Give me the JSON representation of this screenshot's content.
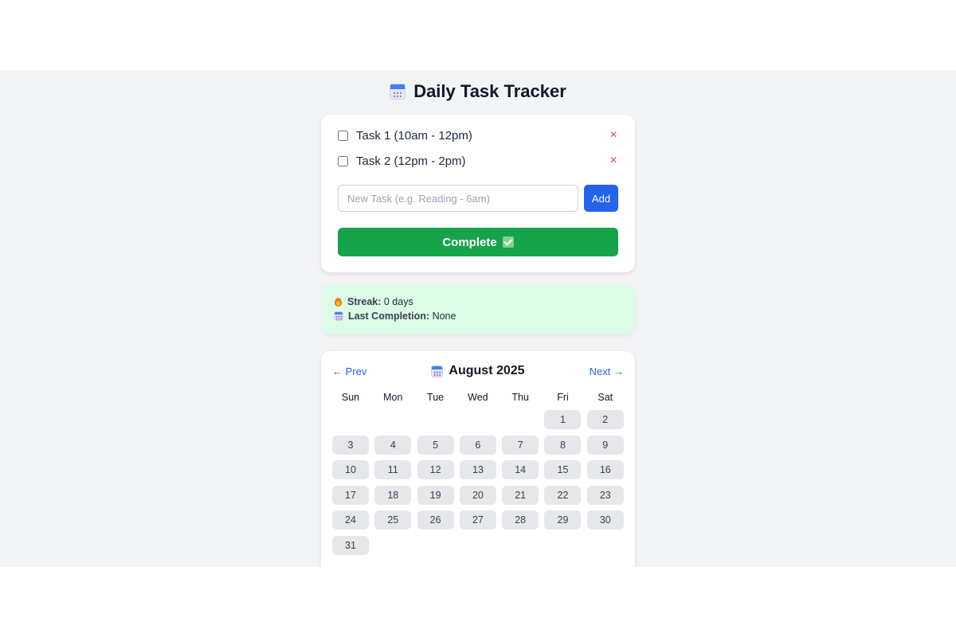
{
  "app": {
    "title": "Daily Task Tracker",
    "title_icon": "calendar-icon"
  },
  "tasks": [
    {
      "label": "Task 1 (10am - 12pm)",
      "checked": false,
      "remove": "×"
    },
    {
      "label": "Task 2 (12pm - 2pm)",
      "checked": false,
      "remove": "×"
    }
  ],
  "new_task": {
    "placeholder": "New Task (e.g. Reading - 6am)",
    "value": "",
    "add_label": "Add"
  },
  "complete": {
    "label": "Complete",
    "icon": "check-box-icon"
  },
  "stats": {
    "streak_label": "Streak:",
    "streak_value": "0 days",
    "streak_icon": "flame-icon",
    "last_label": "Last Completion:",
    "last_value": "None",
    "last_icon": "calendar-icon"
  },
  "calendar": {
    "prev_label": "← Prev",
    "next_label": "Next →",
    "month_label": "August 2025",
    "weekdays": [
      "Sun",
      "Mon",
      "Tue",
      "Wed",
      "Thu",
      "Fri",
      "Sat"
    ],
    "weeks": [
      [
        "",
        "",
        "",
        "",
        "",
        "1",
        "2"
      ],
      [
        "3",
        "4",
        "5",
        "6",
        "7",
        "8",
        "9"
      ],
      [
        "10",
        "11",
        "12",
        "13",
        "14",
        "15",
        "16"
      ],
      [
        "17",
        "18",
        "19",
        "20",
        "21",
        "22",
        "23"
      ],
      [
        "24",
        "25",
        "26",
        "27",
        "28",
        "29",
        "30"
      ],
      [
        "31",
        "",
        "",
        "",
        "",
        "",
        ""
      ]
    ]
  },
  "colors": {
    "primary": "#2563eb",
    "success": "#16a34a",
    "danger": "#ef4444",
    "stats_bg": "#dcfce7",
    "page_bg": "#f3f4f6"
  }
}
